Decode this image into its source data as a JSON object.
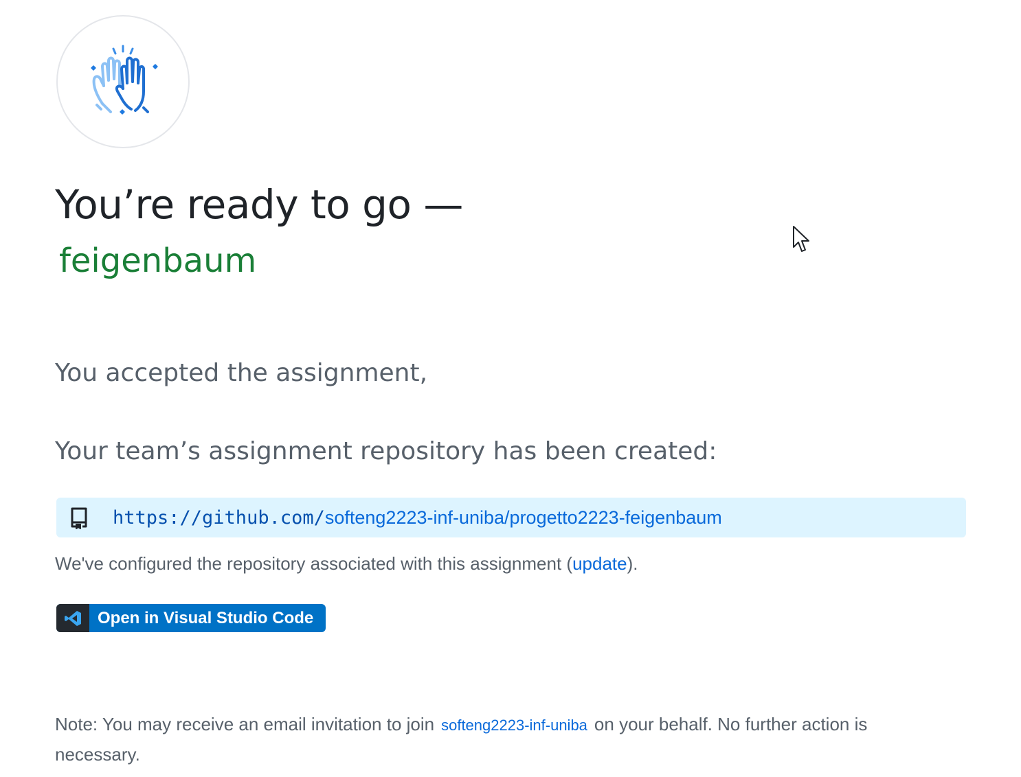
{
  "header": {
    "title": "You’re ready to go —",
    "team_name": "feigenbaum"
  },
  "assignment": {
    "accepted_text": "You accepted the assignment,",
    "created_text": "Your team’s assignment repository has been created:",
    "repo_url_prefix": "https://github.com/",
    "repo_url_path": "softeng2223-inf-uniba/progetto2223-feigenbaum",
    "configured_before": "We've configured the repository associated with this assignment (",
    "configured_link": "update",
    "configured_after": ")."
  },
  "actions": {
    "vscode_label": "Open in Visual Studio Code"
  },
  "note": {
    "before": "Note: You may receive an email invitation to join",
    "org_link": "softeng2223-inf-uniba",
    "after": "on your behalf. No further action is necessary."
  },
  "colors": {
    "link": "#0969da",
    "team_green": "#1a7f37",
    "repo_box_bg": "#ddf4ff",
    "vscode_blue": "#0072c6"
  },
  "icons": [
    "high-five-icon",
    "repo-icon",
    "vscode-icon",
    "mouse-cursor-icon"
  ]
}
